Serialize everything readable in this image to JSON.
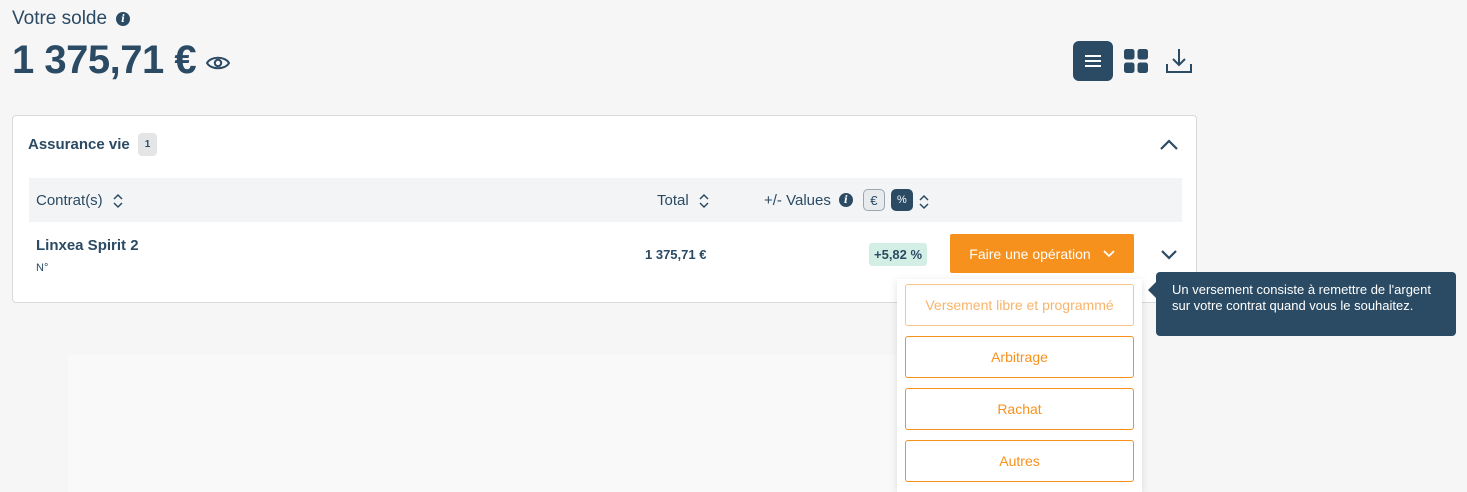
{
  "balance": {
    "label": "Votre solde",
    "amount": "1 375,71 €"
  },
  "view": {
    "active": "list",
    "options": [
      "list-icon",
      "grid-icon",
      "download-icon"
    ]
  },
  "section": {
    "title": "Assurance vie",
    "count": "1"
  },
  "table": {
    "headers": {
      "contract": "Contrat(s)",
      "total": "Total",
      "values": "+/- Values",
      "euro_toggle": "€",
      "percent_toggle": "%"
    },
    "rows": [
      {
        "name": "Linxea Spirit 2",
        "number": "N°",
        "total": "1 375,71 €",
        "performance": "+5,82 %"
      }
    ]
  },
  "operation": {
    "button_label": "Faire une opération",
    "menu": [
      "Versement libre et programmé",
      "Arbitrage",
      "Rachat",
      "Autres"
    ]
  },
  "tooltip": {
    "text": "Un versement consiste à remettre de l'argent sur votre contrat quand vous le souhaitez."
  },
  "colors": {
    "primary": "#2b4a63",
    "accent": "#f7911e",
    "positive_bg": "#d3efe5"
  }
}
